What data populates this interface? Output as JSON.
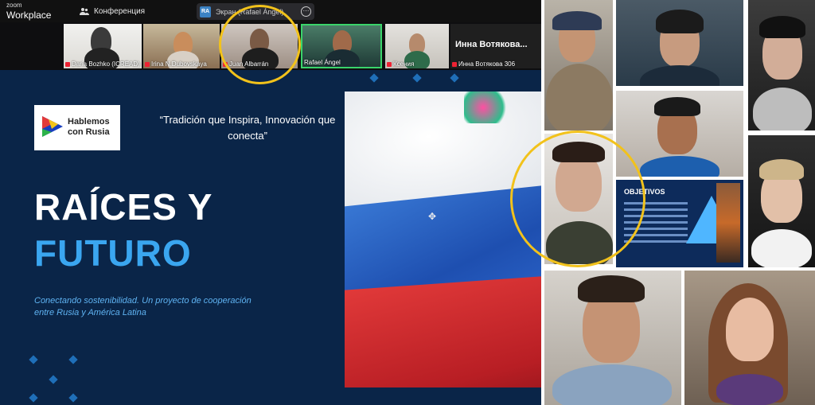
{
  "topbar": {
    "brand_line1": "zoom",
    "brand_line2": "Workplace",
    "conference_label": "Конференция",
    "share_badge": "RA",
    "share_label": "Экран (Rafael Ángel)"
  },
  "participants": [
    {
      "name": "Daria Bozhko (ICREAD)",
      "muted": true
    },
    {
      "name": "Irina N.Dubovskaya",
      "muted": true
    },
    {
      "name": "Juan Albarrán",
      "muted": true
    },
    {
      "name": "Rafael Ángel",
      "muted": false
    },
    {
      "name": "Ксения",
      "muted": true
    },
    {
      "name": "Инна Вотякова 306",
      "muted": true,
      "display_name": "Инна Вотякова..."
    }
  ],
  "slide": {
    "logo_line1": "Hablemos",
    "logo_line2": "con Rusia",
    "quote": "“Tradición que Inspira, Innovación que conecta”",
    "title_line1": "RAÍCES Y",
    "title_line2": "FUTURO",
    "subtitle": "Conectando sostenibilidad. Un proyecto de cooperación entre Rusia y América Latina"
  },
  "shared_slide_thumb": {
    "title": "OBJETIVOS"
  },
  "colors": {
    "slide_bg": "#0a2548",
    "accent_blue": "#3aa6f0",
    "highlight_ring": "#f2c21b",
    "active_speaker": "#3ad46a"
  }
}
